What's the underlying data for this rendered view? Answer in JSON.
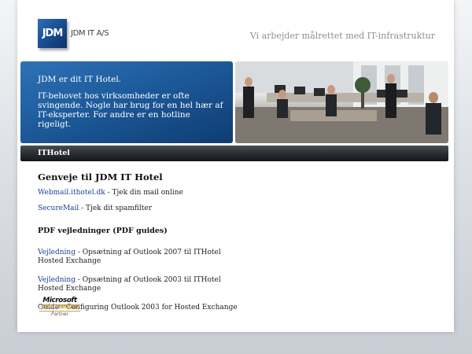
{
  "header": {
    "logo_text": "JDM",
    "company": "JDM IT A/S",
    "tagline": "Vi arbejder målrettet med IT-infrastruktur"
  },
  "banner": {
    "line1": "JDM er dit IT Hotel.",
    "line2": "IT-behovet hos virksomheder er ofte svingende. Nogle har brug for en hel hær af IT-eksperter. For andre er en hotline rigeligt."
  },
  "nav": {
    "item": "ITHotel"
  },
  "content": {
    "heading": "Genveje til JDM IT Hotel",
    "shortcuts": [
      {
        "link": "Webmail.ithotel.dk",
        "text": " - Tjek din mail online"
      },
      {
        "link": "SecureMail",
        "text": " - Tjek dit spamfilter"
      }
    ],
    "pdf_heading": "PDF vejledninger (PDF guides)",
    "guides": [
      {
        "link": "Vejledning",
        "text": " - Opsætning af Outlook 2007 til ITHotel Hosted Exchange"
      },
      {
        "link": "Vejledning",
        "text": " - Opsætning af Outlook 2003 til ITHotel Hosted Exchange"
      },
      {
        "link": "Guide",
        "text": " - Configuring Outlook 2003 for Hosted Exchange"
      }
    ]
  },
  "badge": {
    "brand": "Microsoft",
    "level": "GOLD CERTIFIED",
    "partner": "Partner"
  }
}
